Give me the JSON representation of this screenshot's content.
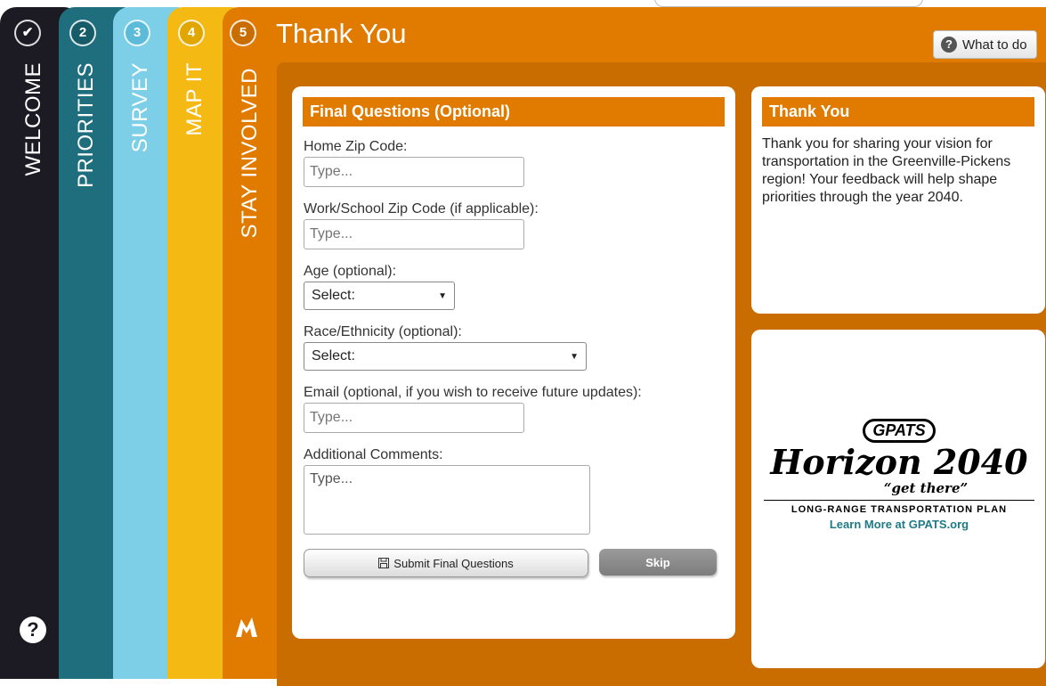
{
  "steps": [
    {
      "number": "✔",
      "label": "WELCOME"
    },
    {
      "number": "2",
      "label": "PRIORITIES"
    },
    {
      "number": "3",
      "label": "SURVEY"
    },
    {
      "number": "4",
      "label": "MAP IT"
    },
    {
      "number": "5",
      "label": "STAY INVOLVED"
    }
  ],
  "header": {
    "title": "Thank You",
    "what_to_do": "What to do"
  },
  "form": {
    "heading": "Final Questions (Optional)",
    "home_zip_label": "Home Zip Code:",
    "home_zip_placeholder": "Type...",
    "work_zip_label": "Work/School Zip Code (if applicable):",
    "work_zip_placeholder": "Type...",
    "age_label": "Age (optional):",
    "age_selected": "Select:",
    "race_label": "Race/Ethnicity (optional):",
    "race_selected": "Select:",
    "email_label": "Email (optional, if you wish to receive future updates):",
    "email_placeholder": "Type...",
    "comments_label": "Additional Comments:",
    "comments_placeholder": "Type...",
    "submit_label": "Submit Final Questions",
    "skip_label": "Skip"
  },
  "thanks": {
    "heading": "Thank You",
    "text": "Thank you for sharing your vision for transportation in the Greenville-Pickens region! Your feedback will help shape priorities through the year 2040."
  },
  "logo": {
    "brand": "GPATS",
    "title": "Horizon 2040",
    "tagline": "“get there”",
    "subtitle": "LONG-RANGE TRANSPORTATION PLAN",
    "link": "Learn More at GPATS.org"
  },
  "colors": {
    "welcome": "#1c1b24",
    "priorities": "#1e6e7d",
    "survey": "#7ccfe7",
    "map_it": "#f4b912",
    "stay_involved": "#e07b00"
  }
}
